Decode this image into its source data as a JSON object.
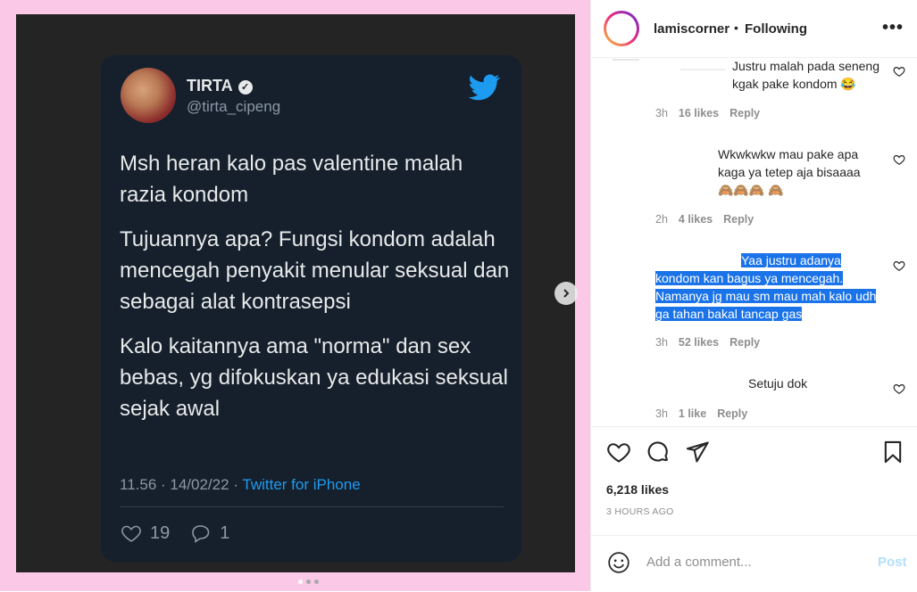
{
  "tweet": {
    "name": "TIRTA",
    "handle": "@tirta_cipeng",
    "paragraphs": [
      "Msh heran kalo pas valentine malah razia kondom",
      "Tujuannya apa? Fungsi kondom adalah mencegah penyakit menular seksual dan sebagai alat kontrasepsi",
      "Kalo kaitannya ama \"norma\" dan sex bebas, yg difokuskan ya edukasi seksual sejak awal"
    ],
    "time_date": "11.56 · 14/02/22 · ",
    "source": "Twitter for iPhone",
    "like_count": "19",
    "reply_count": "1"
  },
  "post": {
    "username": "lamiscorner",
    "separator": "•",
    "follow_status": "Following",
    "more": "•••",
    "likes": "6,218 likes",
    "time_ago": "3 HOURS AGO",
    "add_comment_placeholder": "Add a comment...",
    "post_label": "Post"
  },
  "comments": [
    {
      "text": "Justru malah pada seneng kgak pake kondom 😂",
      "time": "3h",
      "likes": "16 likes",
      "reply": "Reply"
    },
    {
      "text": "Wkwkwkw mau pake apa kaga ya tetep aja bisaaaa 🙈🙈🙈 🙈",
      "time": "2h",
      "likes": "4 likes",
      "reply": "Reply"
    },
    {
      "text": "Yaa justru adanya kondom kan bagus ya mencegah. Namanya jg mau sm mau mah kalo udh ga tahan bakal tancap gas",
      "time": "3h",
      "likes": "52 likes",
      "reply": "Reply"
    },
    {
      "text": "Setuju dok",
      "time": "3h",
      "likes": "1 like",
      "reply": "Reply"
    }
  ]
}
